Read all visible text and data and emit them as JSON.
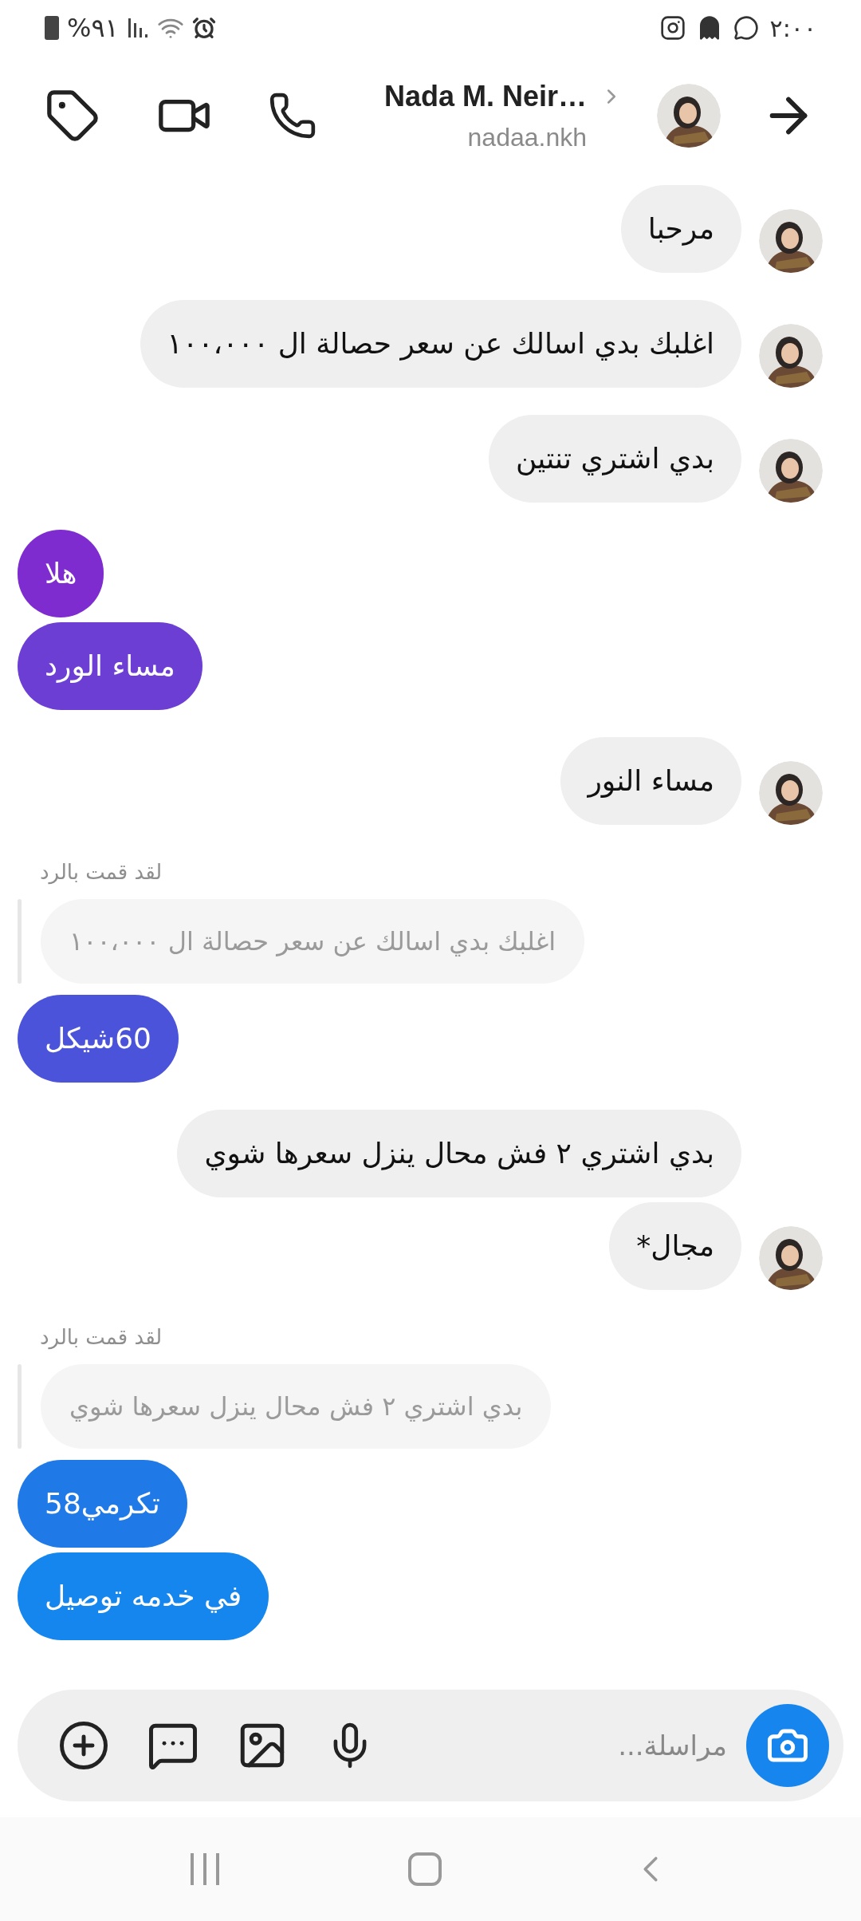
{
  "status_bar": {
    "battery": "%٩١",
    "time": "٢:٠٠"
  },
  "header": {
    "name": "Nada M. Neir…",
    "username": "nadaa.nkh"
  },
  "messages": [
    {
      "kind": "received",
      "text": "مرحبا",
      "avatar": true
    },
    {
      "kind": "received",
      "text": "اغلبك بدي اسالك عن سعر حصالة ال ١٠٠،٠٠٠",
      "avatar": true
    },
    {
      "kind": "received",
      "text": "بدي اشتري تنتين",
      "avatar": true
    },
    {
      "kind": "sent",
      "text": "هلا",
      "color": "#7e2bd0"
    },
    {
      "kind": "sent",
      "text": "مساء الورد",
      "color": "#6c3ed3"
    },
    {
      "kind": "received",
      "text": "مساء النور",
      "avatar": true
    },
    {
      "kind": "reply",
      "label": "لقد قمت بالرد",
      "quote": "اغلبك بدي اسالك عن سعر حصالة ال ١٠٠،٠٠٠"
    },
    {
      "kind": "sent",
      "text": "60شيكل",
      "color": "#4a53d9"
    },
    {
      "kind": "received",
      "text": "بدي اشتري ٢ فش محال ينزل سعرها شوي",
      "avatar": false
    },
    {
      "kind": "received",
      "text": "مجال*",
      "avatar": true
    },
    {
      "kind": "reply",
      "label": "لقد قمت بالرد",
      "quote": "بدي اشتري ٢ فش محال ينزل سعرها شوي"
    },
    {
      "kind": "sent",
      "text": "تكرمي58",
      "color": "#1f7ae8"
    },
    {
      "kind": "sent",
      "text": "في خدمه توصيل",
      "color": "#1586ee"
    }
  ],
  "composer": {
    "placeholder": "مراسلة..."
  }
}
